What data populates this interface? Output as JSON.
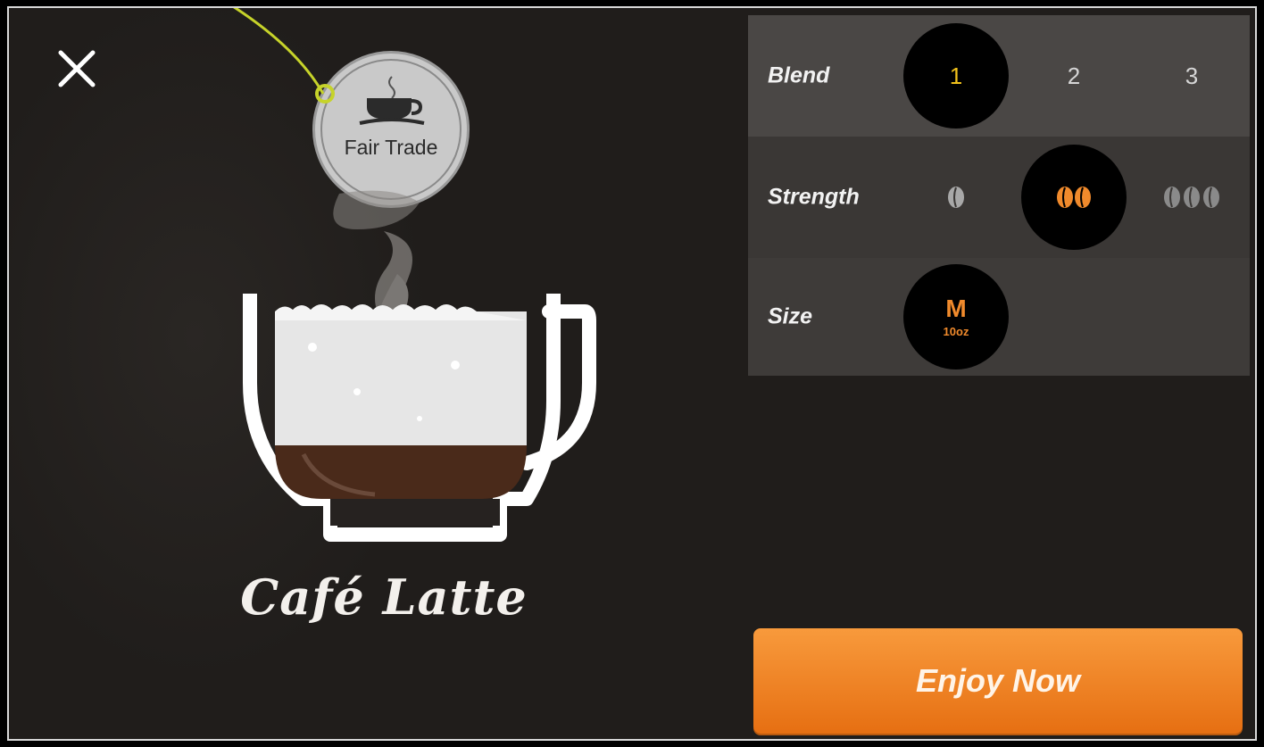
{
  "badge": {
    "label": "Fair Trade"
  },
  "drink": {
    "name": "Café Latte"
  },
  "options": {
    "blend": {
      "label": "Blend",
      "choices": [
        "1",
        "2",
        "3"
      ],
      "selected": "1"
    },
    "strength": {
      "label": "Strength",
      "choices": [
        "mild",
        "medium",
        "strong"
      ],
      "selected": "medium"
    },
    "size": {
      "label": "Size",
      "letter": "M",
      "oz": "10oz"
    }
  },
  "action": {
    "label": "Enjoy Now"
  },
  "colors": {
    "accent": "#f08a2c",
    "selected_number": "#f2c21b",
    "callout": "#c6d32a",
    "background": "#201d1b"
  },
  "icons": [
    "close-icon",
    "fair-trade-cup-icon",
    "bean-icon"
  ]
}
